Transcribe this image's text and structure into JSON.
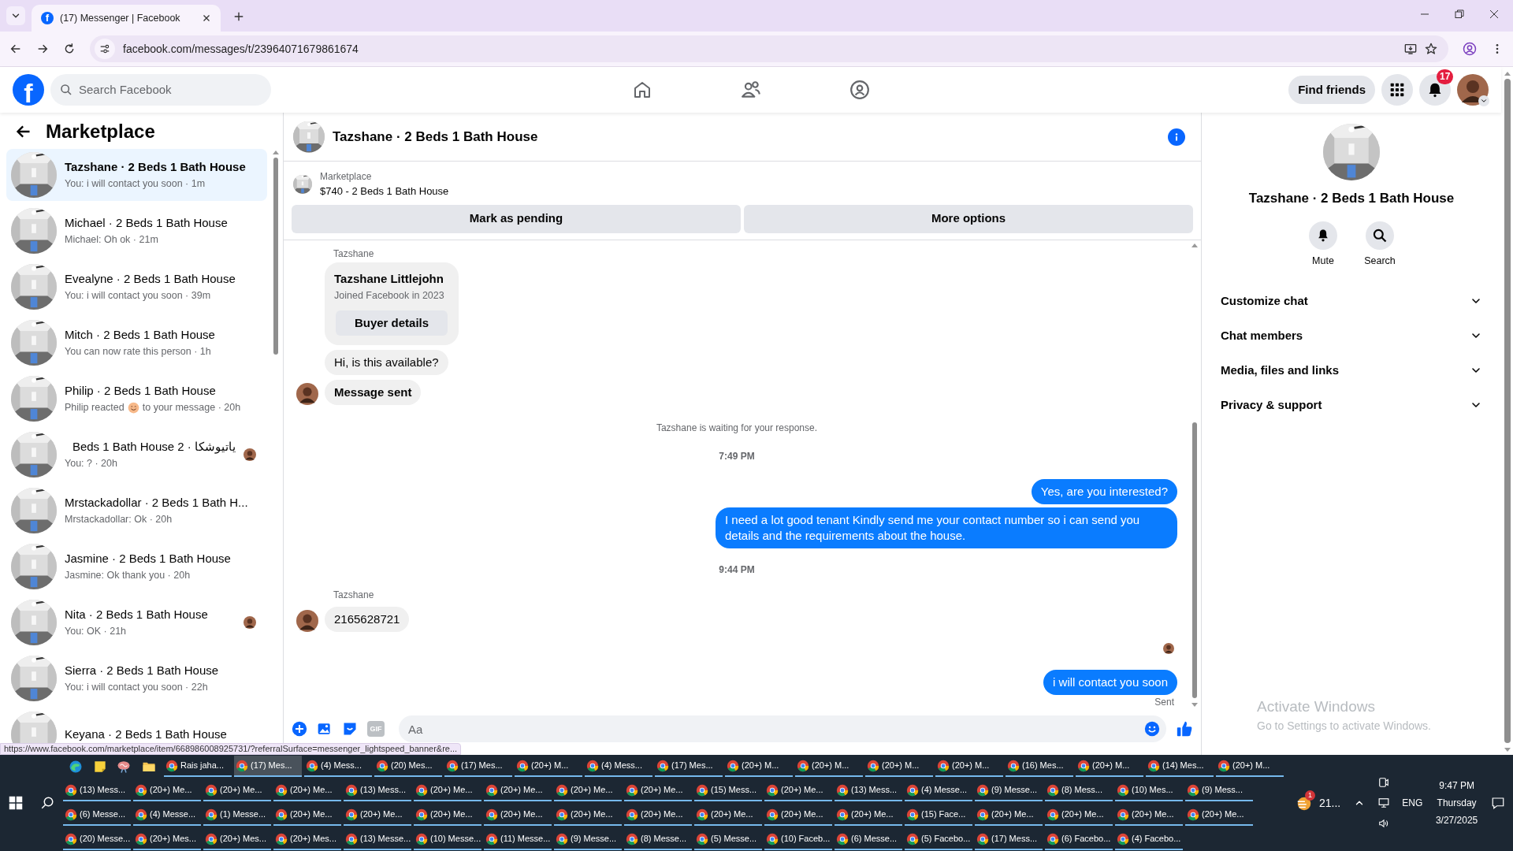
{
  "browser": {
    "tab_title": "(17) Messenger | Facebook",
    "favicon_letter": "f",
    "url": "facebook.com/messages/t/23964071679861674",
    "status_url": "https://www.facebook.com/marketplace/item/668986008925731/?referralSurface=messenger_lightspeed_banner&re..."
  },
  "header": {
    "logo_letter": "f",
    "search_placeholder": "Search Facebook",
    "find_friends": "Find friends",
    "notification_count": "17"
  },
  "sidebar": {
    "title": "Marketplace",
    "conversations": [
      {
        "name": "Tazshane · 2 Beds 1 Bath House",
        "preview": "You: i will contact you soon · 1m",
        "selected": true,
        "side_avatar": false
      },
      {
        "name": "Michael · 2 Beds 1 Bath House",
        "preview": "Michael: Oh ok · 21m",
        "selected": false,
        "side_avatar": false
      },
      {
        "name": "Evealyne · 2 Beds 1 Bath House",
        "preview": "You: i will contact you soon · 39m",
        "selected": false,
        "side_avatar": false
      },
      {
        "name": "Mitch · 2 Beds 1 Bath House",
        "preview": "You can now rate this person · 1h",
        "selected": false,
        "side_avatar": false
      },
      {
        "name": "Philip · 2 Beds 1 Bath House",
        "preview": "Philip reacted",
        "preview_end": "to your message · 20h",
        "selected": false,
        "side_avatar": false
      },
      {
        "name": "ياتيوشكا · 2 Beds 1 Bath House",
        "preview": "You: ? · 20h",
        "selected": false,
        "side_avatar": true
      },
      {
        "name": "Mrstackadollar · 2 Beds 1 Bath H...",
        "preview": "Mrstackadollar: Ok · 20h",
        "selected": false,
        "side_avatar": false
      },
      {
        "name": "Jasmine · 2 Beds 1 Bath House",
        "preview": "Jasmine: Ok thank you · 20h",
        "selected": false,
        "side_avatar": false
      },
      {
        "name": "Nita · 2 Beds 1 Bath House",
        "preview": "You: OK · 21h",
        "selected": false,
        "side_avatar": true
      },
      {
        "name": "Sierra · 2 Beds 1 Bath House",
        "preview": "You: i will contact you soon · 22h",
        "selected": false,
        "side_avatar": false
      },
      {
        "name": "Keyana · 2 Beds 1 Bath House",
        "selected": false
      }
    ]
  },
  "chat": {
    "title": "Tazshane · 2 Beds 1 Bath House",
    "listing_source": "Marketplace",
    "listing_title": "$740 - 2 Beds 1 Bath House",
    "buttons": [
      "Mark as pending",
      "More options"
    ],
    "messages": [
      {
        "kind": "label",
        "text": "Tazshane"
      },
      {
        "kind": "card",
        "name": "Tazshane Littlejohn",
        "detail": "Joined Facebook in 2023",
        "button": "Buyer details"
      },
      {
        "kind": "in",
        "text": "Hi, is this available?",
        "avatar": false,
        "bold": false
      },
      {
        "kind": "in",
        "text": "Message sent",
        "avatar": true,
        "bold": true
      },
      {
        "kind": "notice",
        "text": "Tazshane is waiting for your response."
      },
      {
        "kind": "time",
        "text": "7:49 PM"
      },
      {
        "kind": "out",
        "text": "Yes, are you interested?"
      },
      {
        "kind": "out",
        "text": "I need a lot good tenant Kindly send me your contact number so i can send you details and the requirements about the house."
      },
      {
        "kind": "time",
        "text": "9:44 PM"
      },
      {
        "kind": "label",
        "text": "Tazshane"
      },
      {
        "kind": "in",
        "text": "2165628721",
        "avatar": true,
        "bold": false
      },
      {
        "kind": "seen"
      },
      {
        "kind": "out",
        "text": "i will contact you soon"
      },
      {
        "kind": "status",
        "text": "Sent"
      }
    ],
    "composer": {
      "gif_label": "GIF",
      "placeholder": "Aa"
    }
  },
  "info_panel": {
    "title": "Tazshane · 2 Beds 1 Bath House",
    "actions": [
      {
        "kind": "mute",
        "label": "Mute"
      },
      {
        "kind": "search",
        "label": "Search"
      }
    ],
    "sections": [
      {
        "label": "Customize chat",
        "expanded": false
      },
      {
        "label": "Chat members",
        "expanded": false
      },
      {
        "label": "Media, files and links",
        "expanded": false
      },
      {
        "label": "Privacy & support",
        "expanded": false
      }
    ]
  },
  "watermark": {
    "title": "Activate Windows",
    "subtitle": "Go to Settings to activate Windows."
  },
  "taskbar": {
    "rows": [
      [
        {
          "label": "Rais jaha...",
          "selected": false
        },
        {
          "label": "(17) Mes...",
          "selected": true
        },
        {
          "label": "(4) Mess...",
          "selected": false
        },
        {
          "label": "(20) Mes...",
          "selected": false
        },
        {
          "label": "(17) Mes...",
          "selected": false
        },
        {
          "label": "(20+) M...",
          "selected": false
        },
        {
          "label": "(4) Mess...",
          "selected": false
        },
        {
          "label": "(17) Mes...",
          "selected": false
        },
        {
          "label": "(20+) M...",
          "selected": false
        },
        {
          "label": "(20+) M...",
          "selected": false
        },
        {
          "label": "(20+) M...",
          "selected": false
        },
        {
          "label": "(20+) M...",
          "selected": false
        },
        {
          "label": "(16) Mes...",
          "selected": false
        },
        {
          "label": "(20+) M...",
          "selected": false
        },
        {
          "label": "(14) Mes...",
          "selected": false
        },
        {
          "label": "(20+) M...",
          "selected": false
        }
      ],
      [
        {
          "label": "(13) Mess...",
          "selected": false
        },
        {
          "label": "(20+) Me...",
          "selected": false
        },
        {
          "label": "(20+) Me...",
          "selected": false
        },
        {
          "label": "(20+) Me...",
          "selected": false
        },
        {
          "label": "(13) Mess...",
          "selected": false
        },
        {
          "label": "(20+) Me...",
          "selected": false
        },
        {
          "label": "(20+) Me...",
          "selected": false
        },
        {
          "label": "(20+) Me...",
          "selected": false
        },
        {
          "label": "(20+) Me...",
          "selected": false
        },
        {
          "label": "(15) Mess...",
          "selected": false
        },
        {
          "label": "(20+) Me...",
          "selected": false
        },
        {
          "label": "(13) Mess...",
          "selected": false
        },
        {
          "label": "(4) Messe...",
          "selected": false
        },
        {
          "label": "(9) Messe...",
          "selected": false
        },
        {
          "label": "(8) Mess...",
          "selected": false
        },
        {
          "label": "(10) Mes...",
          "selected": false
        },
        {
          "label": "(9) Mess...",
          "selected": false
        }
      ],
      [
        {
          "label": "(6) Messe...",
          "selected": false
        },
        {
          "label": "(4) Messe...",
          "selected": false
        },
        {
          "label": "(1) Messe...",
          "selected": false
        },
        {
          "label": "(20+) Me...",
          "selected": false
        },
        {
          "label": "(20+) Me...",
          "selected": false
        },
        {
          "label": "(20+) Me...",
          "selected": false
        },
        {
          "label": "(20+) Me...",
          "selected": false
        },
        {
          "label": "(20+) Me...",
          "selected": false
        },
        {
          "label": "(20+) Me...",
          "selected": false
        },
        {
          "label": "(20+) Me...",
          "selected": false
        },
        {
          "label": "(20+) Me...",
          "selected": false
        },
        {
          "label": "(20+) Me...",
          "selected": false
        },
        {
          "label": "(15) Face...",
          "selected": false
        },
        {
          "label": "(20+) Me...",
          "selected": false
        },
        {
          "label": "(20+) Me...",
          "selected": false
        },
        {
          "label": "(20+) Me...",
          "selected": false
        },
        {
          "label": "(20+) Me...",
          "selected": false
        }
      ],
      [
        {
          "label": "(20) Messe...",
          "selected": false
        },
        {
          "label": "(20+) Mes...",
          "selected": false
        },
        {
          "label": "(20+) Mes...",
          "selected": false
        },
        {
          "label": "(20+) Mes...",
          "selected": false
        },
        {
          "label": "(13) Messe...",
          "selected": false
        },
        {
          "label": "(10) Messe...",
          "selected": false
        },
        {
          "label": "(11) Messe...",
          "selected": false
        },
        {
          "label": "(9) Messe...",
          "selected": false
        },
        {
          "label": "(8) Messe...",
          "selected": false
        },
        {
          "label": "(5) Messe...",
          "selected": false
        },
        {
          "label": "(10) Faceb...",
          "selected": false
        },
        {
          "label": "(6) Messe...",
          "selected": false
        },
        {
          "label": "(5) Facebo...",
          "selected": false
        },
        {
          "label": "(17) Mess...",
          "selected": false
        },
        {
          "label": "(6) Facebo...",
          "selected": false
        },
        {
          "label": "(4) Facebo...",
          "selected": false
        }
      ]
    ],
    "tray": {
      "weather_badge": "1",
      "weather_text": "21...",
      "language": "ENG",
      "time": "9:47 PM",
      "day": "Thursday",
      "date": "3/27/2025"
    }
  }
}
